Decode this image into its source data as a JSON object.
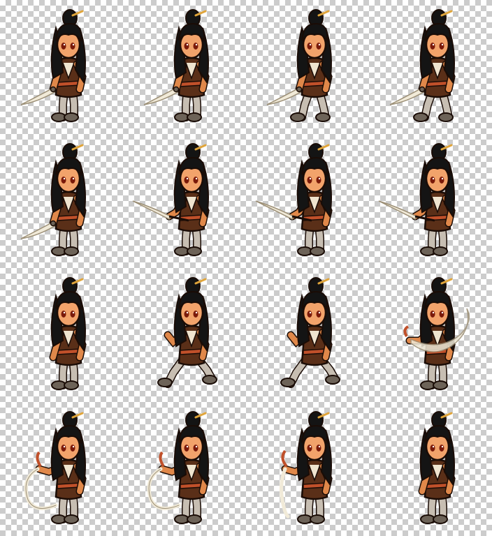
{
  "sheet": {
    "checker_light": "#ffffff",
    "checker_dark": "#cccccc",
    "columns": 4,
    "rows": 4
  },
  "palette": {
    "hair": "#141414",
    "hair_highlight": "#3a3a3a",
    "skin": "#e0884a",
    "skin_shade": "#b8612c",
    "face": "#f2a36b",
    "eye": "#7a1a0a",
    "tunic": "#5a2f18",
    "tunic_light": "#7a4422",
    "sash": "#c0502a",
    "undershirt": "#efe4cf",
    "pants": "#c7beb2",
    "boots": "#6d6358",
    "blade": "#f1ead8",
    "blade_edge": "#9c8f76",
    "hairpin": "#e0a53a",
    "outline": "#1a0c06"
  },
  "frames": [
    {
      "id": "idle-1",
      "pose": "idle",
      "facing": "left",
      "weapon": "sword-low"
    },
    {
      "id": "idle-2",
      "pose": "idle",
      "facing": "left",
      "weapon": "sword-low"
    },
    {
      "id": "walk-1",
      "pose": "walk",
      "facing": "left",
      "weapon": "sword-low"
    },
    {
      "id": "walk-2",
      "pose": "walk",
      "facing": "left",
      "weapon": "sword-low"
    },
    {
      "id": "guard-1",
      "pose": "idle",
      "facing": "left",
      "weapon": "sword-low"
    },
    {
      "id": "thrust-1",
      "pose": "thrust",
      "facing": "left",
      "weapon": "sword-forward"
    },
    {
      "id": "thrust-2",
      "pose": "thrust",
      "facing": "left",
      "weapon": "sword-forward"
    },
    {
      "id": "thrust-3",
      "pose": "thrust",
      "facing": "left",
      "weapon": "sword-forward"
    },
    {
      "id": "stance-1",
      "pose": "idle",
      "facing": "left",
      "weapon": "none"
    },
    {
      "id": "dash-1",
      "pose": "dash",
      "facing": "left",
      "weapon": "none"
    },
    {
      "id": "dash-2",
      "pose": "dash",
      "facing": "left",
      "weapon": "none"
    },
    {
      "id": "slash-1",
      "pose": "slash",
      "facing": "left",
      "weapon": "slash-arc"
    },
    {
      "id": "whip-1",
      "pose": "whip",
      "facing": "left",
      "weapon": "whip-arc"
    },
    {
      "id": "whip-2",
      "pose": "whip",
      "facing": "left",
      "weapon": "whip-arc"
    },
    {
      "id": "whip-3",
      "pose": "whip",
      "facing": "left",
      "weapon": "whip-down"
    },
    {
      "id": "stand-1",
      "pose": "idle",
      "facing": "left",
      "weapon": "none"
    }
  ]
}
